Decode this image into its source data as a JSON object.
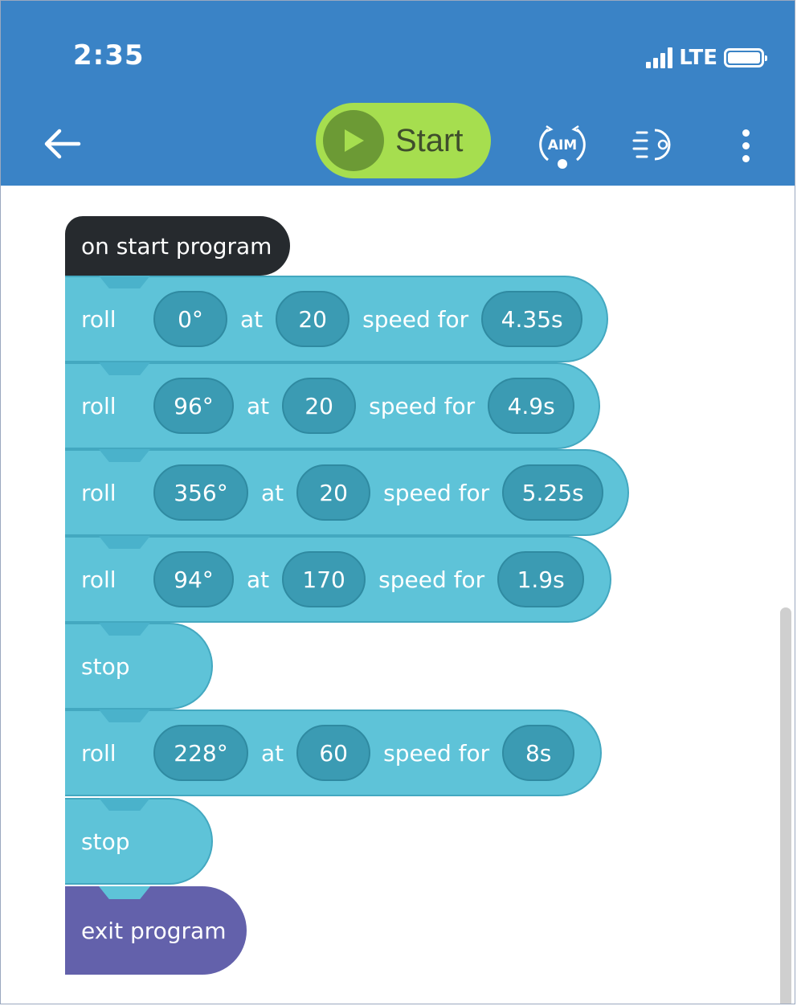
{
  "status_bar": {
    "time": "2:35",
    "network": "LTE"
  },
  "header": {
    "start_label": "Start",
    "aim_label": "AIM"
  },
  "program": {
    "start_block": "on start program",
    "blocks": [
      {
        "type": "roll",
        "keyword": "roll",
        "heading": "0°",
        "at": "at",
        "speed": "20",
        "speed_for": "speed for",
        "duration": "4.35s"
      },
      {
        "type": "roll",
        "keyword": "roll",
        "heading": "96°",
        "at": "at",
        "speed": "20",
        "speed_for": "speed for",
        "duration": "4.9s"
      },
      {
        "type": "roll",
        "keyword": "roll",
        "heading": "356°",
        "at": "at",
        "speed": "20",
        "speed_for": "speed for",
        "duration": "5.25s"
      },
      {
        "type": "roll",
        "keyword": "roll",
        "heading": "94°",
        "at": "at",
        "speed": "170",
        "speed_for": "speed for",
        "duration": "1.9s"
      },
      {
        "type": "stop",
        "keyword": "stop"
      },
      {
        "type": "roll",
        "keyword": "roll",
        "heading": "228°",
        "at": "at",
        "speed": "60",
        "speed_for": "speed for",
        "duration": "8s"
      },
      {
        "type": "stop",
        "keyword": "stop"
      }
    ],
    "exit_block": "exit program"
  },
  "colors": {
    "header": "#3a83c6",
    "start_button": "#a6de4f",
    "start_block": "#262a2e",
    "movement_block": "#5ec3d8",
    "value_pill": "#3b9bb3",
    "exit_block": "#6361ab"
  },
  "icons": [
    "back-arrow-icon",
    "play-icon",
    "aim-icon",
    "speed-icon",
    "more-vertical-icon",
    "signal-icon",
    "battery-icon"
  ]
}
